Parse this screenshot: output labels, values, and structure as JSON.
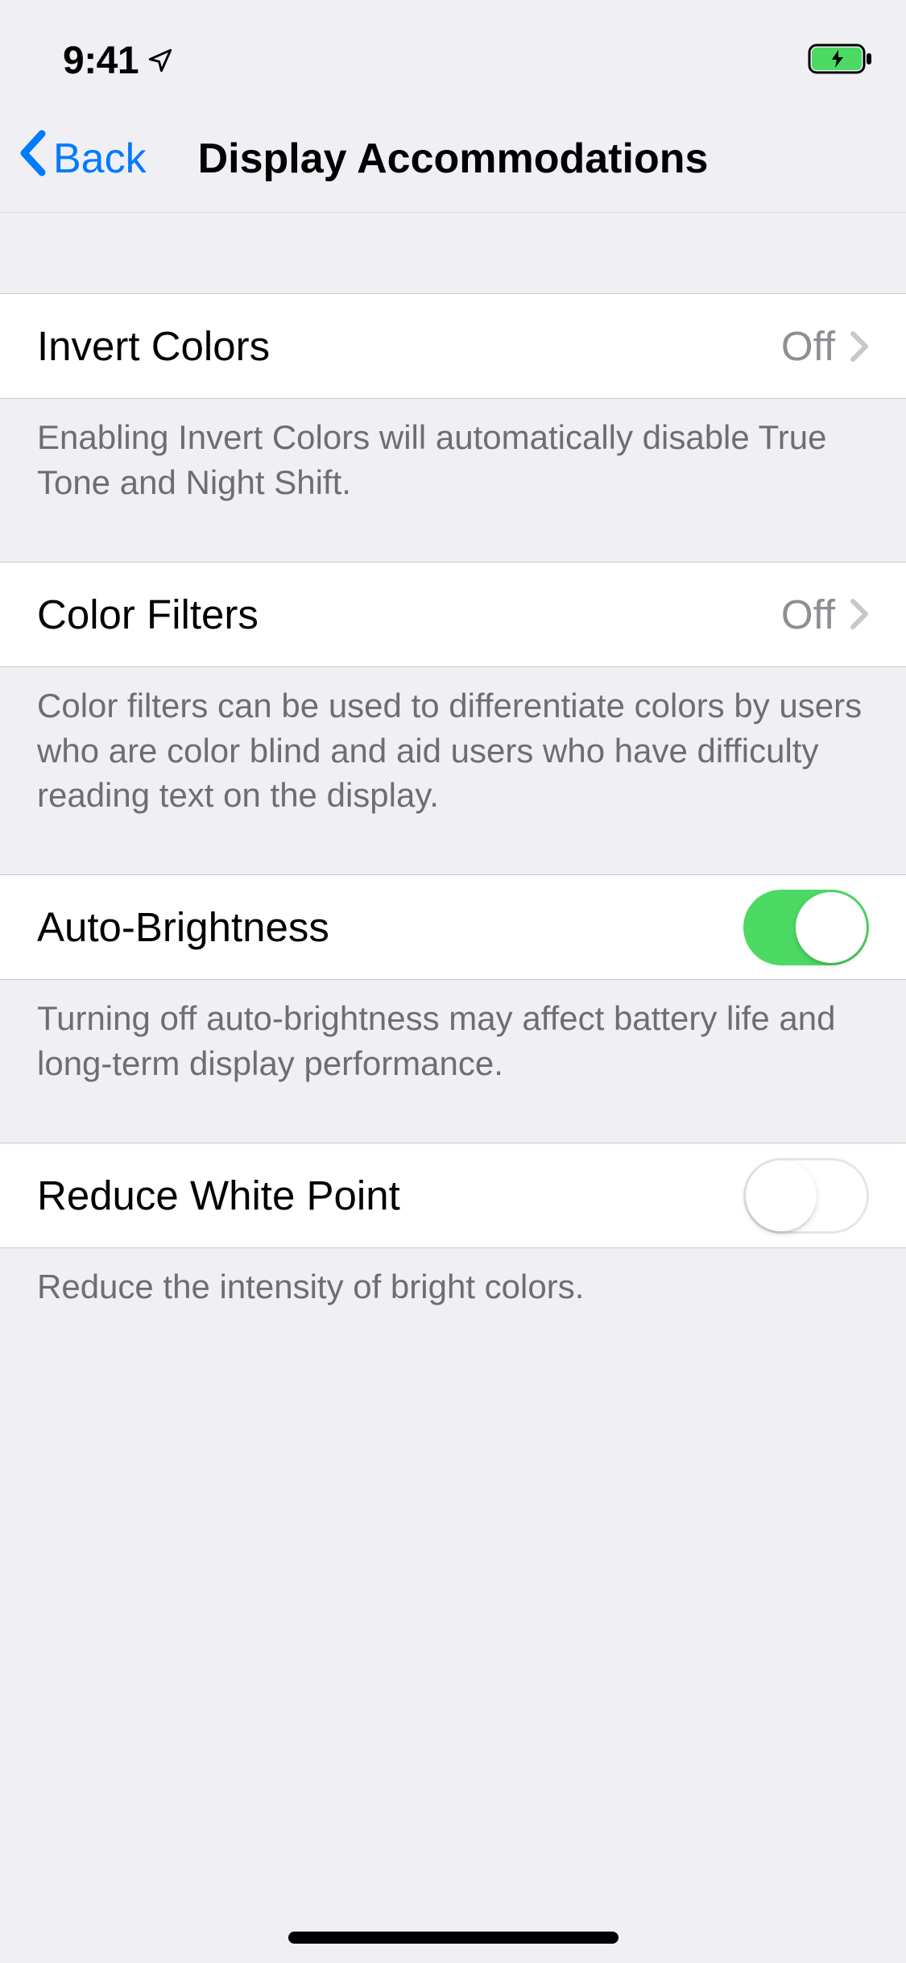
{
  "statusBar": {
    "time": "9:41"
  },
  "nav": {
    "back": "Back",
    "title": "Display Accommodations"
  },
  "rows": {
    "invertColors": {
      "label": "Invert Colors",
      "value": "Off",
      "footer": "Enabling Invert Colors will automatically disable True Tone and Night Shift."
    },
    "colorFilters": {
      "label": "Color Filters",
      "value": "Off",
      "footer": "Color filters can be used to differentiate colors by users who are color blind and aid users who have difficulty reading text on the display."
    },
    "autoBrightness": {
      "label": "Auto-Brightness",
      "on": true,
      "footer": "Turning off auto-brightness may affect battery life and long-term display performance."
    },
    "reduceWhitePoint": {
      "label": "Reduce White Point",
      "on": false,
      "footer": "Reduce the intensity of bright colors."
    }
  }
}
